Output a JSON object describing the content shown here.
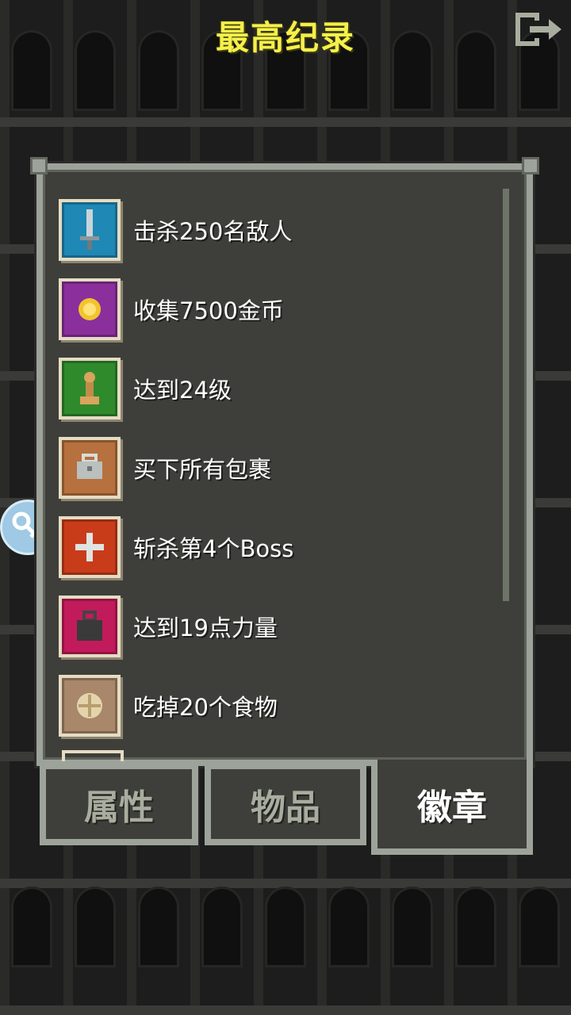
{
  "header": {
    "title": "最高纪录"
  },
  "badges": [
    {
      "label": "击杀250名敌人",
      "icon": "sword-icon",
      "color": "#1f88b5"
    },
    {
      "label": "收集7500金币",
      "icon": "gold-coin-icon",
      "color": "#8b2f9c"
    },
    {
      "label": "达到24级",
      "icon": "pawn-icon",
      "color": "#2f8a2c"
    },
    {
      "label": "买下所有包裹",
      "icon": "bag-icon",
      "color": "#b6713e"
    },
    {
      "label": "斩杀第4个Boss",
      "icon": "cross-icon",
      "color": "#c93c1a"
    },
    {
      "label": "达到19点力量",
      "icon": "weight-icon",
      "color": "#c21b5b"
    },
    {
      "label": "吃掉20个食物",
      "icon": "food-icon",
      "color": "#a8876a"
    }
  ],
  "tabs": [
    {
      "label": "属性",
      "active": false
    },
    {
      "label": "物品",
      "active": false
    },
    {
      "label": "徽章",
      "active": true
    }
  ],
  "colors": {
    "title": "#f5f04a",
    "panel_bg": "#3e3f3a",
    "panel_border": "#9da39a",
    "key_button": "#9fc9e4"
  }
}
